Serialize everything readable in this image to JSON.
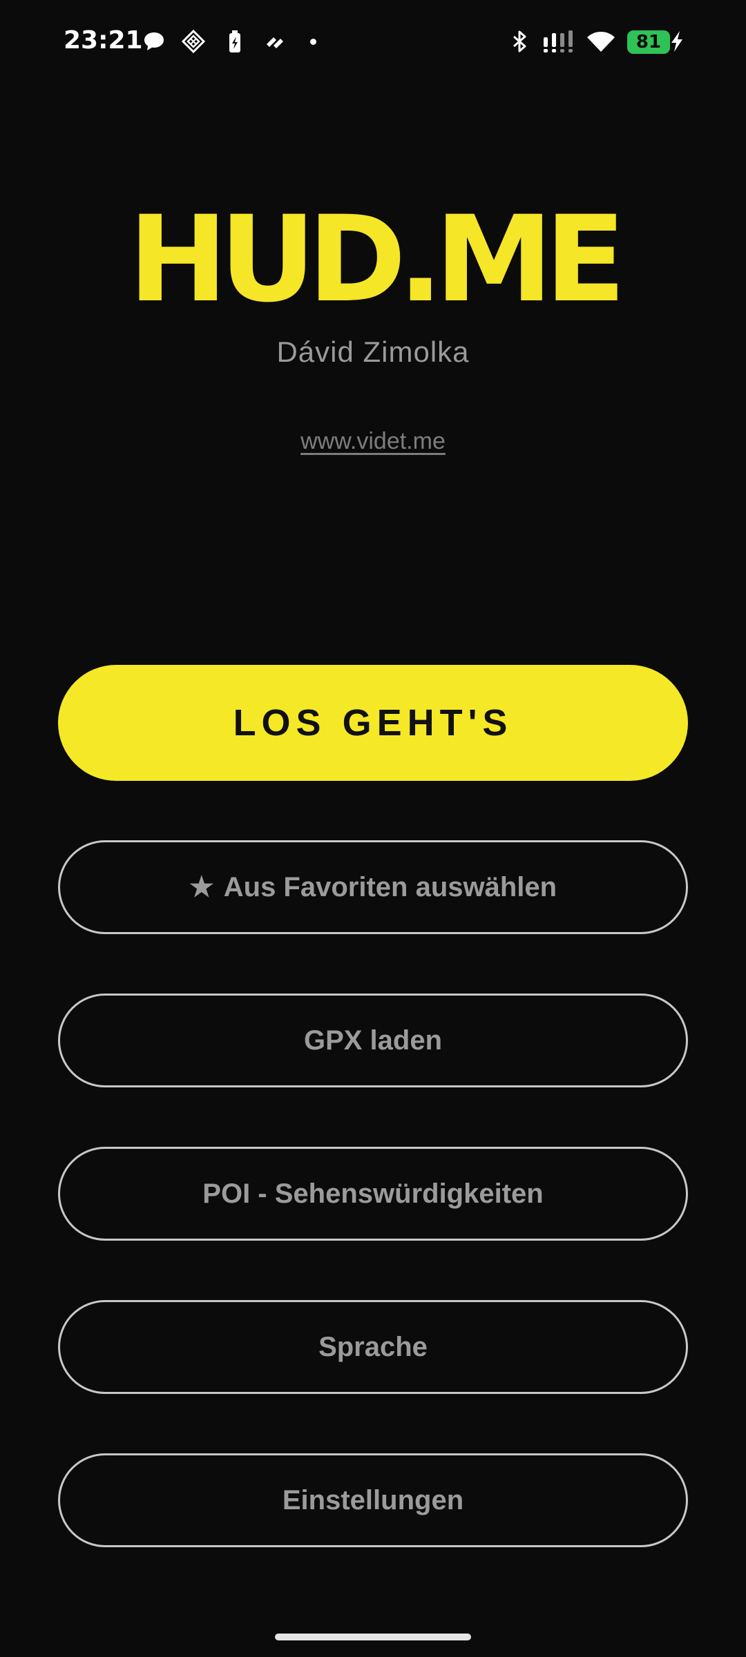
{
  "status_bar": {
    "time": "23:21",
    "battery_level": "81",
    "icons": [
      "chat-bubble-icon",
      "diamond-grid-icon",
      "battery-saver-icon",
      "link-app-icon",
      "notification-dot-icon",
      "bluetooth-icon",
      "signal-icon",
      "wifi-icon",
      "battery-icon",
      "charging-bolt-icon"
    ],
    "battery_color": "#2fc257"
  },
  "header": {
    "logo": "HUD.ME",
    "author": "Dávid Zimolka",
    "website": "www.videt.me"
  },
  "menu": {
    "start": "LOS GEHT'S",
    "favorites_icon": "★",
    "favorites": "Aus Favoriten auswählen",
    "gpx": "GPX laden",
    "poi": "POI - Sehenswürdigkeiten",
    "language": "Sprache",
    "settings": "Einstellungen"
  },
  "colors": {
    "background": "#0b0b0b",
    "accent": "#f5e827",
    "button_text": "#9b9b9b",
    "outline": "#c8c8c8"
  }
}
